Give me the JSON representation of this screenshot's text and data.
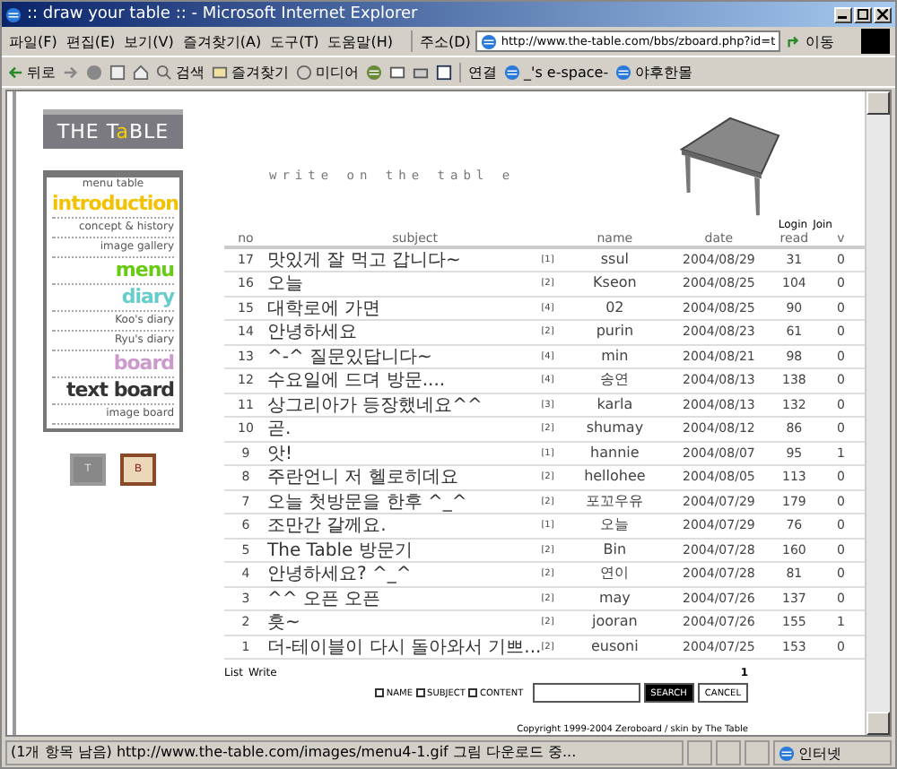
{
  "window": {
    "title": ":: draw your table :: - Microsoft Internet Explorer"
  },
  "menu_bar": [
    "파일(F)",
    "편집(E)",
    "보기(V)",
    "즐겨찾기(A)",
    "도구(T)",
    "도움말(H)"
  ],
  "address": {
    "label": "주소(D)",
    "value": "http://www.the-table.com/bbs/zboard.php?id=t",
    "go": "이동"
  },
  "toolbar": {
    "back": "뒤로",
    "search": "검색",
    "favorites": "즐겨찾기",
    "media": "미디어",
    "links_label": "연결",
    "links": [
      "_'s e-space-",
      "야후한몰"
    ]
  },
  "sidebar": {
    "logo": {
      "before": "THE T",
      "accent": "a",
      "after": "BLE"
    },
    "menu": [
      {
        "kind": "caption",
        "label": "menu table"
      },
      {
        "kind": "heading",
        "label": "introduction",
        "color": "#f2c200"
      },
      {
        "kind": "sub",
        "label": "concept & history"
      },
      {
        "kind": "sub",
        "label": "image gallery"
      },
      {
        "kind": "heading",
        "label": "menu",
        "color": "#66cc11"
      },
      {
        "kind": "heading",
        "label": "diary",
        "color": "#66cccc"
      },
      {
        "kind": "sub",
        "label": "Koo's diary"
      },
      {
        "kind": "sub",
        "label": "Ryu's diary"
      },
      {
        "kind": "heading",
        "label": "board",
        "color": "#cc99cc"
      },
      {
        "kind": "heading",
        "label": "text board",
        "color": "#333333"
      },
      {
        "kind": "sub",
        "label": "image board"
      }
    ],
    "squares": [
      {
        "label": "T",
        "selected": false
      },
      {
        "label": "B",
        "selected": true
      }
    ]
  },
  "banner": {
    "text": "write on the tabl e"
  },
  "links": [
    "Login",
    "Join"
  ],
  "table": {
    "columns": [
      "no",
      "subject",
      "name",
      "date",
      "read",
      "v"
    ],
    "rows": [
      {
        "no": "17",
        "subject": "맛있게 잘 먹고 갑니다~",
        "comments": "[1]",
        "name": "ssul",
        "date": "2004/08/29",
        "read": "31",
        "v": "0"
      },
      {
        "no": "16",
        "subject": "오늘",
        "comments": "[2]",
        "name": "Kseon",
        "date": "2004/08/25",
        "read": "104",
        "v": "0"
      },
      {
        "no": "15",
        "subject": "대학로에 가면",
        "comments": "[4]",
        "name": "02",
        "date": "2004/08/25",
        "read": "90",
        "v": "0"
      },
      {
        "no": "14",
        "subject": "안녕하세요",
        "comments": "[2]",
        "name": "purin",
        "date": "2004/08/23",
        "read": "61",
        "v": "0"
      },
      {
        "no": "13",
        "subject": "^-^ 질문있답니다~",
        "comments": "[4]",
        "name": "min",
        "date": "2004/08/21",
        "read": "98",
        "v": "0"
      },
      {
        "no": "12",
        "subject": "수요일에 드뎌 방문....",
        "comments": "[4]",
        "name": "송연",
        "date": "2004/08/13",
        "read": "138",
        "v": "0"
      },
      {
        "no": "11",
        "subject": "상그리아가 등장했네요^^",
        "comments": "[3]",
        "name": "karla",
        "date": "2004/08/13",
        "read": "132",
        "v": "0"
      },
      {
        "no": "10",
        "subject": "곧.",
        "comments": "[2]",
        "name": "shumay",
        "date": "2004/08/12",
        "read": "86",
        "v": "0"
      },
      {
        "no": "9",
        "subject": "앗!",
        "comments": "[1]",
        "name": "hannie",
        "date": "2004/08/07",
        "read": "95",
        "v": "1"
      },
      {
        "no": "8",
        "subject": "주란언니 저 헬로히데요",
        "comments": "[2]",
        "name": "hellohee",
        "date": "2004/08/05",
        "read": "113",
        "v": "0"
      },
      {
        "no": "7",
        "subject": "오늘 첫방문을 한후 ^_^",
        "comments": "[2]",
        "name": "포꼬우유",
        "date": "2004/07/29",
        "read": "179",
        "v": "0"
      },
      {
        "no": "6",
        "subject": "조만간 갈께요.",
        "comments": "[1]",
        "name": "오늘",
        "date": "2004/07/29",
        "read": "76",
        "v": "0"
      },
      {
        "no": "5",
        "subject": "The Table 방문기",
        "comments": "[2]",
        "name": "Bin",
        "date": "2004/07/28",
        "read": "160",
        "v": "0"
      },
      {
        "no": "4",
        "subject": "안녕하세요? ^_^",
        "comments": "[2]",
        "name": "연이",
        "date": "2004/07/28",
        "read": "81",
        "v": "0"
      },
      {
        "no": "3",
        "subject": "^^ 오픈 오픈",
        "comments": "[2]",
        "name": "may",
        "date": "2004/07/26",
        "read": "137",
        "v": "0"
      },
      {
        "no": "2",
        "subject": "흣~",
        "comments": "[2]",
        "name": "jooran",
        "date": "2004/07/26",
        "read": "155",
        "v": "1"
      },
      {
        "no": "1",
        "subject": "더-테이블이 다시 돌아와서 기쁘...",
        "comments": "[2]",
        "name": "eusoni",
        "date": "2004/07/25",
        "read": "153",
        "v": "0"
      }
    ]
  },
  "footer": {
    "links": [
      "List",
      "Write"
    ],
    "page": "1",
    "search_options": [
      {
        "label": "NAME",
        "checked": false
      },
      {
        "label": "SUBJECT",
        "checked": false
      },
      {
        "label": "CONTENT",
        "checked": false
      }
    ],
    "search_button": "SEARCH",
    "cancel_button": "CANCEL",
    "copyright": "Copyright 1999-2004 Zeroboard / skin by The Table"
  },
  "status_bar": {
    "text": "(1개 항목 남음) http://www.the-table.com/images/menu4-1.gif 그림 다운로드 중...",
    "zone": "인터넷"
  }
}
